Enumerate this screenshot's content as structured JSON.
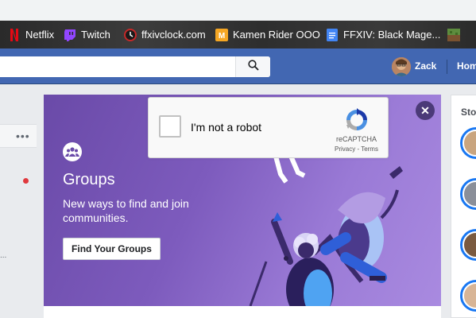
{
  "bookmarks": [
    {
      "label": "Netflix",
      "icon": "netflix-icon",
      "color": "#e50914"
    },
    {
      "label": "Twitch",
      "icon": "twitch-icon",
      "color": "#9146ff"
    },
    {
      "label": "ffxivclock.com",
      "icon": "ffxivclock-icon",
      "color": "#c62828"
    },
    {
      "label": "Kamen Rider OOO",
      "icon": "kamen-rider-icon",
      "color": "#f5a623"
    },
    {
      "label": "FFXIV: Black Mage...",
      "icon": "docs-icon",
      "color": "#4285f4"
    },
    {
      "label": "",
      "icon": "minecraft-icon",
      "color": "#5d8c3e"
    }
  ],
  "header": {
    "user_name": "Zack",
    "home_label": "Hom",
    "brand_color": "#4267b2"
  },
  "promo": {
    "title": "Groups",
    "subtitle": "New ways to find and join communities.",
    "button_label": "Find Your Groups",
    "close_symbol": "✕"
  },
  "captcha": {
    "label": "I'm not a robot",
    "brand": "reCAPTCHA",
    "links": "Privacy - Terms"
  },
  "right": {
    "stories_title": "Sto"
  },
  "left": {
    "more_symbol": "•••"
  }
}
